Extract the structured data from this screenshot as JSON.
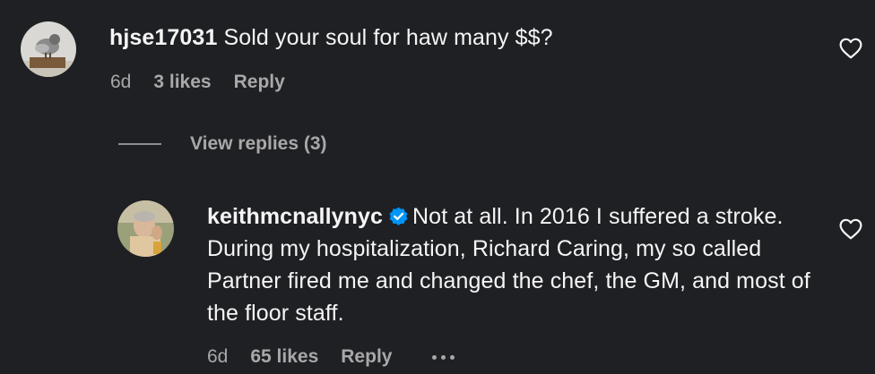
{
  "comment1": {
    "username": "hjse17031",
    "text": "Sold your soul for haw many $$?",
    "time": "6d",
    "likes": "3 likes",
    "reply": "Reply"
  },
  "view_replies": "View replies (3)",
  "comment2": {
    "username": "keithmcnallynyc",
    "text": "Not at all. In 2016 I suffered a stroke. During my hospitalization, Richard Caring, my so called Partner fired me and changed the chef, the GM, and most of the floor staff.",
    "time": "6d",
    "likes": "65 likes",
    "reply": "Reply"
  },
  "icons": {
    "like": "heart-outline-icon",
    "verified": "verified-badge-icon",
    "more": "more-horizontal-icon"
  },
  "colors": {
    "background": "#1f2024",
    "text": "#f5f5f5",
    "secondary": "#a8a8a8",
    "verified": "#0095f6"
  }
}
